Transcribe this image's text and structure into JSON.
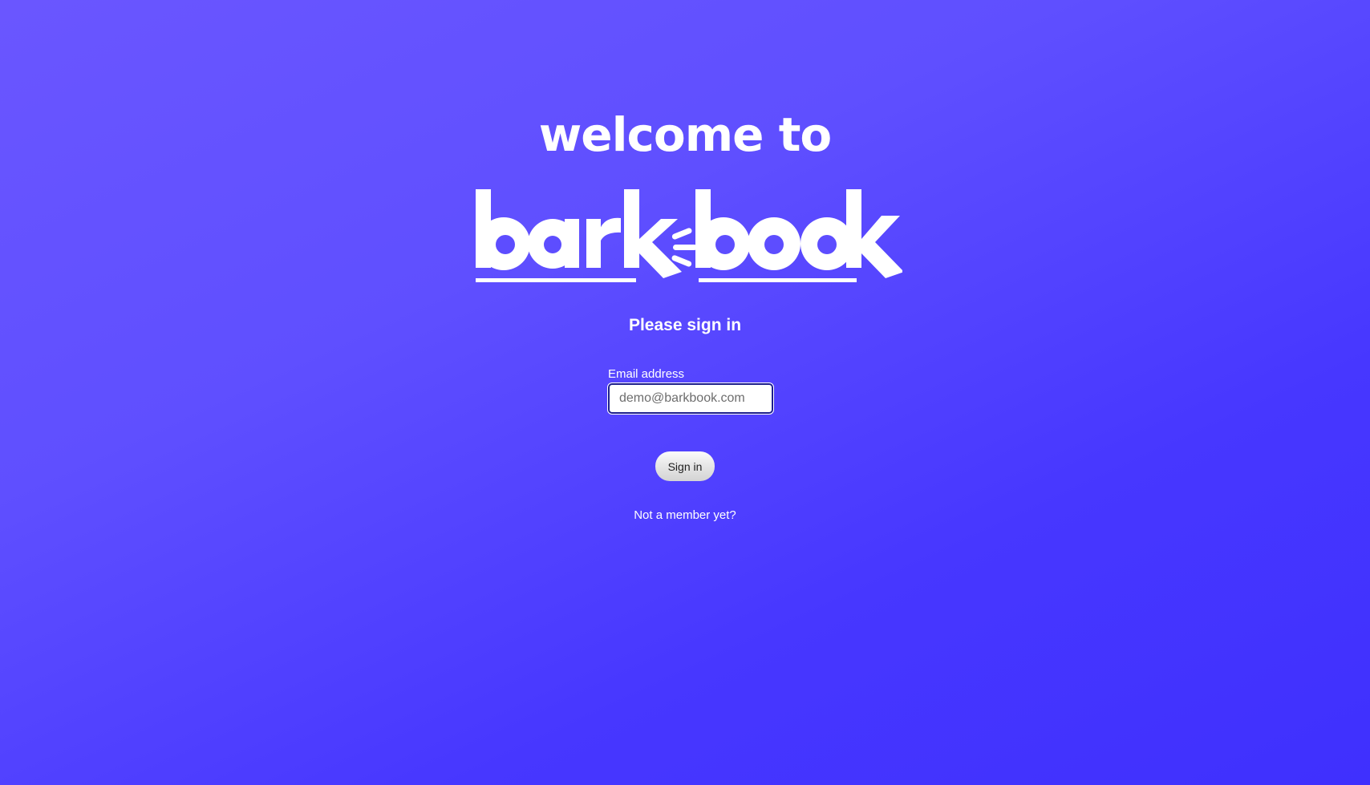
{
  "page": {
    "welcome_text": "welcome to",
    "brand_logo_text": "barkbook",
    "heading": "Please sign in",
    "background_colors": [
      "#6a56ff",
      "#3f30fe"
    ]
  },
  "form": {
    "email_label": "Email address",
    "email_value": "",
    "email_placeholder": "demo@barkbook.com",
    "submit_label": "Sign in",
    "signup_link_text": "Not a member yet?"
  }
}
